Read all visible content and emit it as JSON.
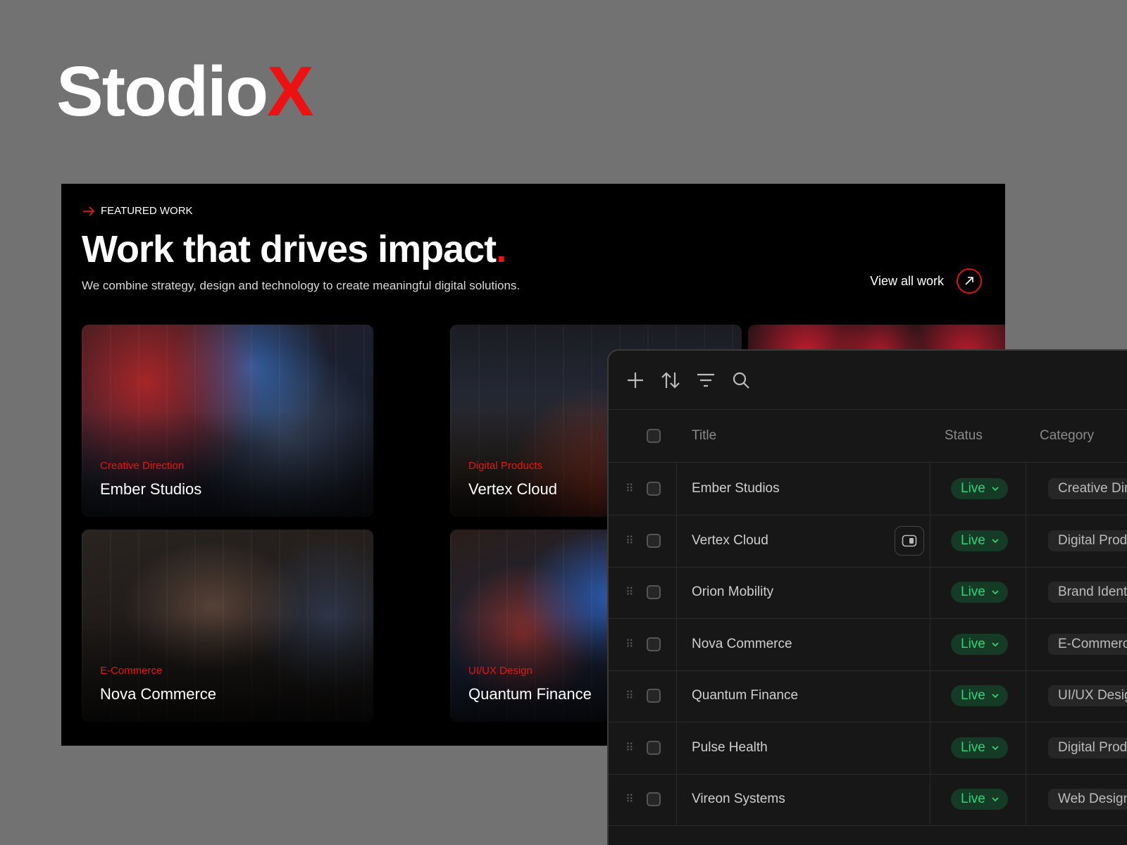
{
  "brand": {
    "name": "Stodio",
    "accent_letter": "X",
    "accent_color": "#ee1111"
  },
  "featured": {
    "eyebrow": "FEATURED WORK",
    "headline": "Work that drives impact",
    "headline_dot": ".",
    "subtitle": "We combine strategy, design and technology to create meaningful digital solutions.",
    "view_all": "View all work",
    "cards": [
      {
        "category": "Creative Direction",
        "title": "Ember Studios"
      },
      {
        "category": "Digital Products",
        "title": "Vertex Cloud"
      },
      {
        "category": "",
        "title": ""
      },
      {
        "category": "E-Commerce",
        "title": "Nova Commerce"
      },
      {
        "category": "UI/UX Design",
        "title": "Quantum Finance"
      }
    ]
  },
  "table": {
    "toolbar": [
      "add-icon",
      "sort-icon",
      "filter-icon",
      "search-icon"
    ],
    "columns": {
      "title": "Title",
      "status": "Status",
      "category": "Category"
    },
    "rows": [
      {
        "title": "Ember Studios",
        "status": "Live",
        "category": "Creative Direction"
      },
      {
        "title": "Vertex Cloud",
        "status": "Live",
        "category": "Digital Products"
      },
      {
        "title": "Orion Mobility",
        "status": "Live",
        "category": "Brand Identity"
      },
      {
        "title": "Nova Commerce",
        "status": "Live",
        "category": "E-Commerce"
      },
      {
        "title": "Quantum Finance",
        "status": "Live",
        "category": "UI/UX Design"
      },
      {
        "title": "Pulse Health",
        "status": "Live",
        "category": "Digital Products"
      },
      {
        "title": "Vireon Systems",
        "status": "Live",
        "category": "Web Design"
      }
    ],
    "status_color": "#2fd27a"
  }
}
